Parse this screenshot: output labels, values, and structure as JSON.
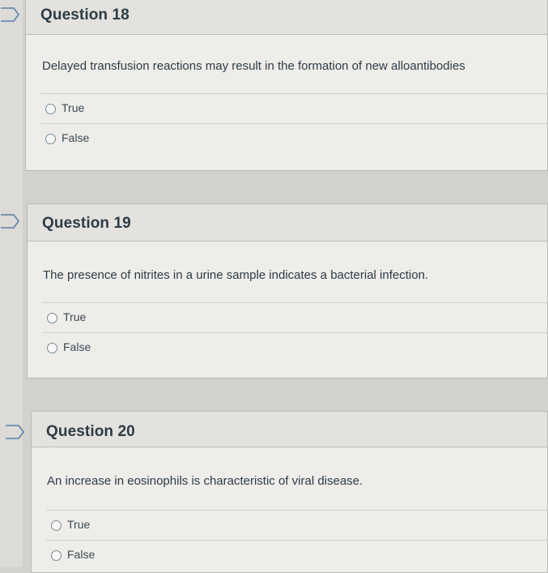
{
  "questions": [
    {
      "title": "Question 18",
      "text": "Delayed transfusion reactions may result in the formation of new alloantibodies",
      "answers": [
        "True",
        "False"
      ]
    },
    {
      "title": "Question 19",
      "text": "The presence of nitrites in a urine sample indicates a bacterial infection.",
      "answers": [
        "True",
        "False"
      ]
    },
    {
      "title": "Question 20",
      "text": "An increase in eosinophils is characteristic of viral disease.",
      "answers": [
        "True",
        "False"
      ]
    }
  ],
  "icons": {
    "flag": "flag-question-icon",
    "radio": "radio-unselected-icon"
  }
}
